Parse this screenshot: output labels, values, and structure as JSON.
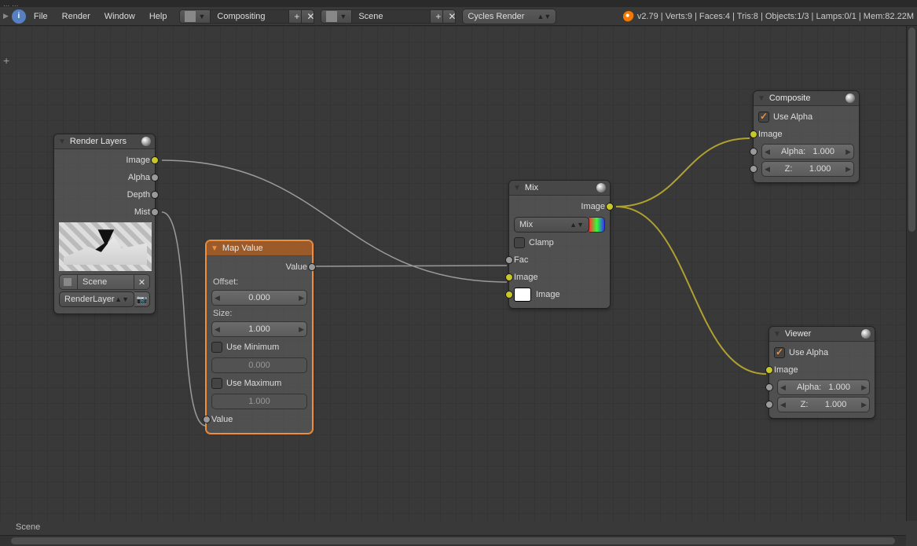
{
  "topbar_path": "...  ...",
  "menu": {
    "file": "File",
    "render": "Render",
    "window": "Window",
    "help": "Help"
  },
  "header": {
    "screen_layout": "Compositing",
    "scene": "Scene",
    "engine": "Cycles Render"
  },
  "stats": "v2.79 | Verts:9 | Faces:4 | Tris:8 | Objects:1/3 | Lamps:0/1 | Mem:82.22M",
  "footer": "Scene",
  "nodes": {
    "render_layers": {
      "title": "Render Layers",
      "outputs": {
        "image": "Image",
        "alpha": "Alpha",
        "depth": "Depth",
        "mist": "Mist"
      },
      "scene_field": "Scene",
      "layer_field": "RenderLayer"
    },
    "map_value": {
      "title": "Map Value",
      "out_value": "Value",
      "offset_label": "Offset:",
      "offset_value": "0.000",
      "size_label": "Size:",
      "size_value": "1.000",
      "use_min": "Use Minimum",
      "min_value": "0.000",
      "use_max": "Use Maximum",
      "max_value": "1.000",
      "in_value": "Value"
    },
    "mix": {
      "title": "Mix",
      "out_image": "Image",
      "blend": "Mix",
      "clamp": "Clamp",
      "in_fac": "Fac",
      "in_image1": "Image",
      "in_image2": "Image"
    },
    "composite": {
      "title": "Composite",
      "use_alpha": "Use Alpha",
      "in_image": "Image",
      "alpha_label": "Alpha:",
      "alpha_value": "1.000",
      "z_label": "Z:",
      "z_value": "1.000"
    },
    "viewer": {
      "title": "Viewer",
      "use_alpha": "Use Alpha",
      "in_image": "Image",
      "alpha_label": "Alpha:",
      "alpha_value": "1.000",
      "z_label": "Z:",
      "z_value": "1.000"
    }
  }
}
